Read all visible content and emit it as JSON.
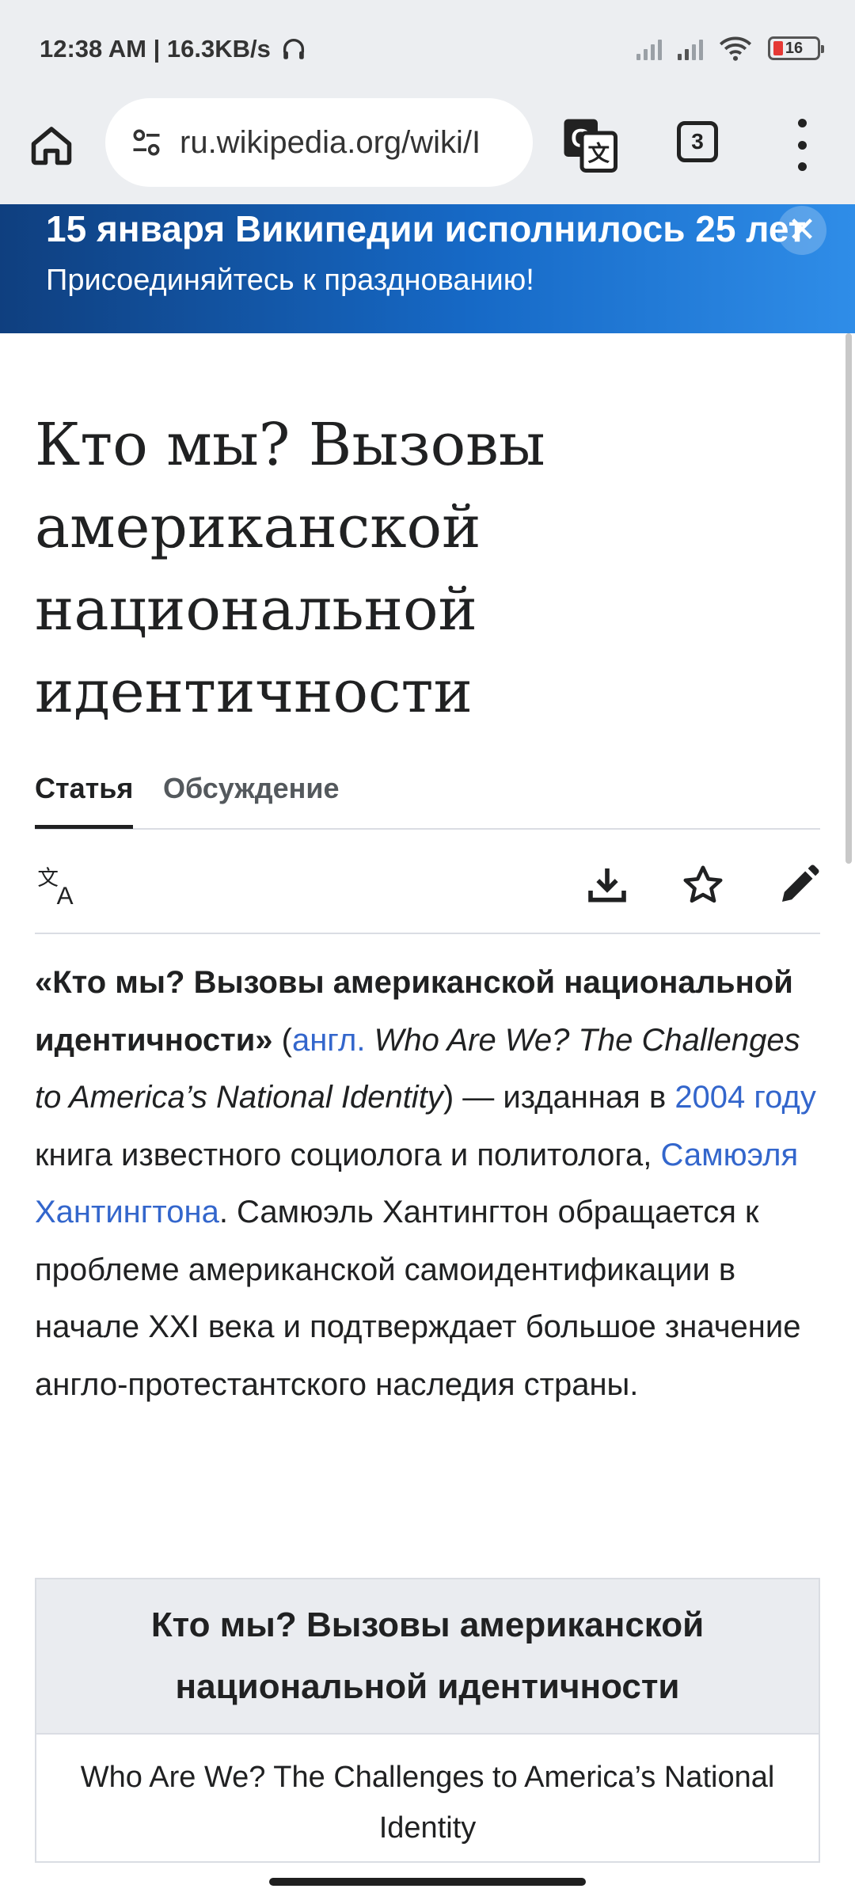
{
  "status_bar": {
    "time_speed": "12:38 AM | 16.3KB/s",
    "battery": "16",
    "battery_color": "#e53935"
  },
  "browser": {
    "url": "ru.wikipedia.org/wiki/I",
    "tab_count": "3",
    "icons": [
      "home-icon",
      "site-settings-icon",
      "translate-icon",
      "more-vert-icon"
    ]
  },
  "banner": {
    "title": "15 января Википедии исполнилось 25 лет",
    "subtitle": "Присоединяйтесь к празднованию!",
    "close_glyph": "✕",
    "gradient_colors": [
      "#0f3f7f",
      "#1669c6",
      "#2f8de8"
    ]
  },
  "article": {
    "title": "Кто мы? Вызовы американской национальной идентичности",
    "tabs": [
      {
        "label": "Статья",
        "active": true
      },
      {
        "label": "Обсуждение",
        "active": false
      }
    ],
    "lead": {
      "bold_title": "«Кто мы? Вызовы американской национальной идентичности»",
      "paren_open": " (",
      "lang_link": "англ.",
      "english_title": "Who Are We? The Challenges to America’s National Identity",
      "text1": ") — изданная в ",
      "year_link": "2004 году",
      "text2": " книга известного социолога и политолога, ",
      "author_link": "Самюэля Хантингтона",
      "text3": ". Самюэль Хантингтон обращается к проблеме американской самоидентификации в начале XXI века и подтверждает большое значение англо-протестантского наследия страны."
    },
    "infobox": {
      "title": "Кто мы? Вызовы американской национальной идентичности",
      "original_title": "Who Are We? The Challenges to America’s National Identity"
    },
    "link_color": "#3366cc"
  }
}
